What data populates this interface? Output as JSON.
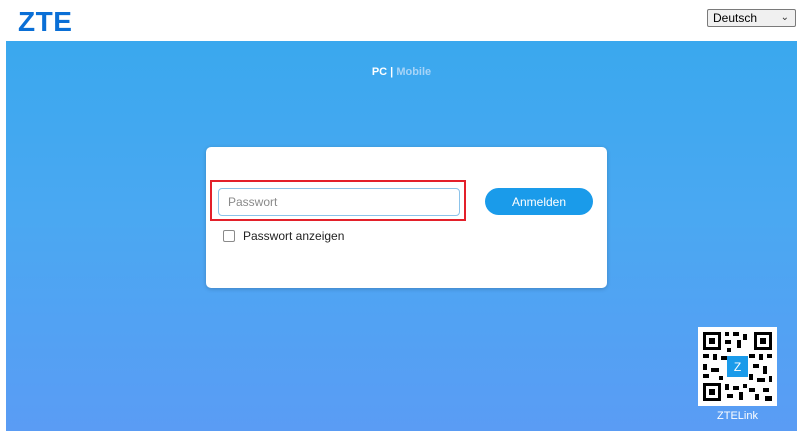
{
  "header": {
    "logo_text": "ZTE",
    "language": {
      "selected": "Deutsch",
      "icon": "chevron-down-icon"
    }
  },
  "mode_switch": {
    "pc_label": "PC",
    "separator": "|",
    "mobile_label": "Mobile"
  },
  "login": {
    "password_placeholder": "Passwort",
    "password_value": "",
    "submit_label": "Anmelden",
    "show_password_label": "Passwort anzeigen",
    "show_password_checked": false
  },
  "qr": {
    "label": "ZTELink",
    "icon": "ztelink-logo-icon"
  },
  "colors": {
    "brand": "#0a6fd6",
    "button": "#1a9bea",
    "highlight": "#e3202a",
    "background_top": "#3aa8ee",
    "background_bottom": "#5a9cf4"
  }
}
